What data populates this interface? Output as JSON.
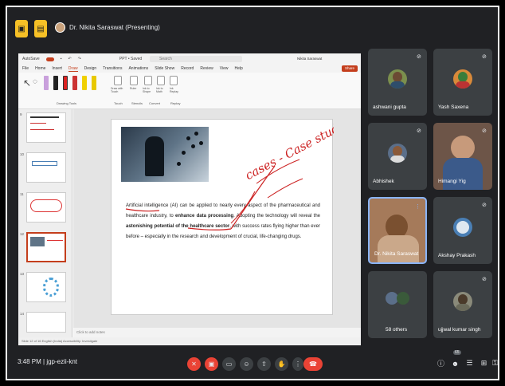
{
  "top_bar": {
    "presenter_label": "Dr. Nikita Saraswat (Presenting)"
  },
  "ppt": {
    "autosave": "AutoSave",
    "file_name": "PPT • Saved",
    "search_placeholder": "Search",
    "user_name": "Nikita Saraswat",
    "menu": [
      "File",
      "Home",
      "Insert",
      "Draw",
      "Design",
      "Transitions",
      "Animations",
      "Slide Show",
      "Record",
      "Review",
      "View",
      "Help"
    ],
    "active_menu": "Draw",
    "share_label": "Share",
    "ribbon": {
      "drawing_tools_label": "Drawing Tools",
      "groups": [
        "Draw with Touch",
        "Ruler",
        "Ink to Shape",
        "Ink to Math",
        "Ink Replay"
      ],
      "group_labels": [
        "Touch",
        "Stencils",
        "Convert",
        "Replay"
      ]
    },
    "slide_numbers": [
      "9",
      "10",
      "11",
      "12",
      "13",
      "14"
    ],
    "slide_text_parts": {
      "p1": "Artificial intelligence (AI) can be applied to nearly every aspect of the pharmaceutical and healthcare industry, to ",
      "p2": "enhance data processing",
      "p3": ". Adopting the technology will reveal the ",
      "p4": "astonishing potential of the healthcare sector",
      "p5": ", with success rates flying higher than ever before – especially in the research and development of crucial, life-changing drugs."
    },
    "handwriting": "cases - Case studies",
    "notes_placeholder": "Click to add notes",
    "status_text": "Slide 12 of 16    English (India)    Accessibility: Investigate"
  },
  "participants": [
    {
      "name": "ashwani gupta",
      "muted": true,
      "color": "#7b8f4d"
    },
    {
      "name": "Yash Saxena",
      "muted": true,
      "color": "#d98a3a"
    },
    {
      "name": "Abhishek",
      "muted": true,
      "color": "#5b6f8a"
    },
    {
      "name": "Himangi Yig",
      "muted": true,
      "color": "#7d5a4d"
    },
    {
      "name": "Dr. Nikita Saraswat",
      "muted": false,
      "color": "#a57a5a"
    },
    {
      "name": "Akshay Prakash",
      "muted": true,
      "color": "#4a7fb5"
    },
    {
      "name": "58 others",
      "muted": false,
      "color": "#3c4043"
    },
    {
      "name": "ujjwal kumar singh",
      "muted": true,
      "color": "#8a8a7a"
    }
  ],
  "bottom_bar": {
    "time": "3:48 PM",
    "meeting_code": "jgp-ezii-knt",
    "people_count": "65"
  },
  "icons": [
    "mic-off-icon",
    "camera-off-icon",
    "captions-icon",
    "present-icon",
    "raise-hand-icon",
    "more-icon",
    "end-call-icon",
    "info-icon",
    "people-icon",
    "chat-icon",
    "activities-icon",
    "lock-icon"
  ]
}
